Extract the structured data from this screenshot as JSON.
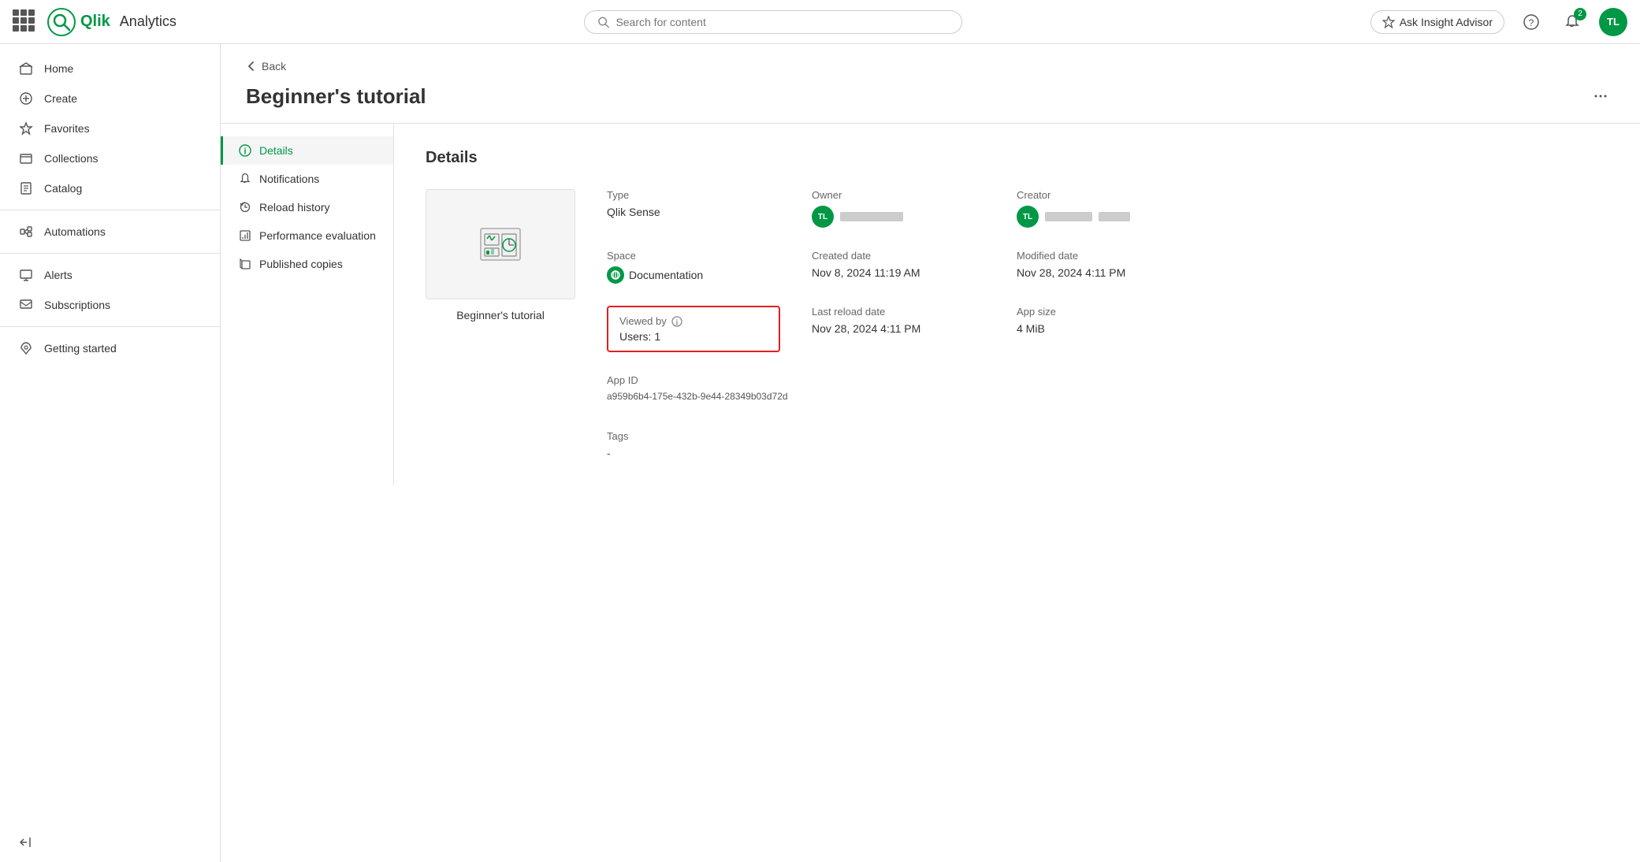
{
  "app": {
    "name": "Analytics"
  },
  "navbar": {
    "search_placeholder": "Search for content",
    "insight_btn": "Ask Insight Advisor",
    "notification_badge": "2",
    "avatar_initials": "TL"
  },
  "sidebar": {
    "items": [
      {
        "id": "home",
        "label": "Home",
        "icon": "home"
      },
      {
        "id": "create",
        "label": "Create",
        "icon": "plus"
      },
      {
        "id": "favorites",
        "label": "Favorites",
        "icon": "star"
      },
      {
        "id": "collections",
        "label": "Collections",
        "icon": "collections"
      },
      {
        "id": "catalog",
        "label": "Catalog",
        "icon": "catalog"
      },
      {
        "id": "automations",
        "label": "Automations",
        "icon": "automations"
      },
      {
        "id": "alerts",
        "label": "Alerts",
        "icon": "alerts"
      },
      {
        "id": "subscriptions",
        "label": "Subscriptions",
        "icon": "subscriptions"
      },
      {
        "id": "getting-started",
        "label": "Getting started",
        "icon": "rocket"
      }
    ],
    "collapse_label": "Collapse"
  },
  "back_label": "Back",
  "page_title": "Beginner's tutorial",
  "more_options_label": "...",
  "sub_nav": {
    "items": [
      {
        "id": "details",
        "label": "Details",
        "active": true
      },
      {
        "id": "notifications",
        "label": "Notifications"
      },
      {
        "id": "reload-history",
        "label": "Reload history"
      },
      {
        "id": "performance",
        "label": "Performance evaluation"
      },
      {
        "id": "published",
        "label": "Published copies"
      }
    ]
  },
  "details": {
    "section_title": "Details",
    "app_name": "Beginner's tutorial",
    "type_label": "Type",
    "type_value": "Qlik Sense",
    "owner_label": "Owner",
    "creator_label": "Creator",
    "space_label": "Space",
    "space_value": "Documentation",
    "created_date_label": "Created date",
    "created_date_value": "Nov 8, 2024 11:19 AM",
    "modified_date_label": "Modified date",
    "modified_date_value": "Nov 28, 2024 4:11 PM",
    "viewed_by_label": "Viewed by",
    "viewed_by_info": "ℹ",
    "viewed_by_value": "Users: 1",
    "last_reload_label": "Last reload date",
    "last_reload_value": "Nov 28, 2024 4:11 PM",
    "app_size_label": "App size",
    "app_size_value": "4 MiB",
    "app_id_label": "App ID",
    "app_id_value": "a959b6b4-175e-432b-9e44-28349b03d72d",
    "tags_label": "Tags",
    "tags_value": "-",
    "owner_initials": "TL",
    "creator_initials": "TL"
  }
}
